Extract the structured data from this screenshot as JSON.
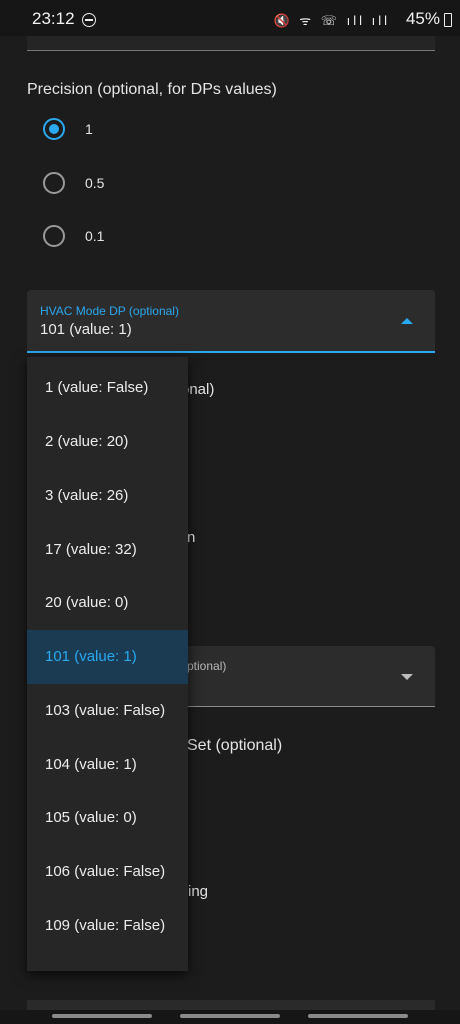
{
  "status_bar": {
    "time": "23:12",
    "icons_text": "🔇 ᯤ ☏ ıll ıll",
    "battery": "45%"
  },
  "precision": {
    "label": "Precision (optional, for DPs values)",
    "options": [
      {
        "label": "1",
        "selected": true
      },
      {
        "label": "0.5",
        "selected": false
      },
      {
        "label": "0.1",
        "selected": false
      }
    ]
  },
  "hvac_mode": {
    "label": "HVAC Mode DP (optional)",
    "value": "101 (value: 1)",
    "label_color": "#2aa8f0",
    "options": [
      "1 (value: False)",
      "2 (value: 20)",
      "3 (value: 26)",
      "17 (value: 32)",
      "20 (value: 0)",
      "101 (value: 1)",
      "103 (value: False)",
      "104 (value: 1)",
      "105 (value: 0)",
      "106 (value: False)",
      "109 (value: False)"
    ],
    "selected_index": 5
  },
  "behind_menu": {
    "text1": "onal)",
    "text2": "n",
    "field_label": "ptional)",
    "text3": "Set (optional)",
    "text4": "ing"
  },
  "colors": {
    "accent": "#2aa8f0",
    "background": "#1c1c1c",
    "menu_selected_bg": "#1a3b52"
  }
}
